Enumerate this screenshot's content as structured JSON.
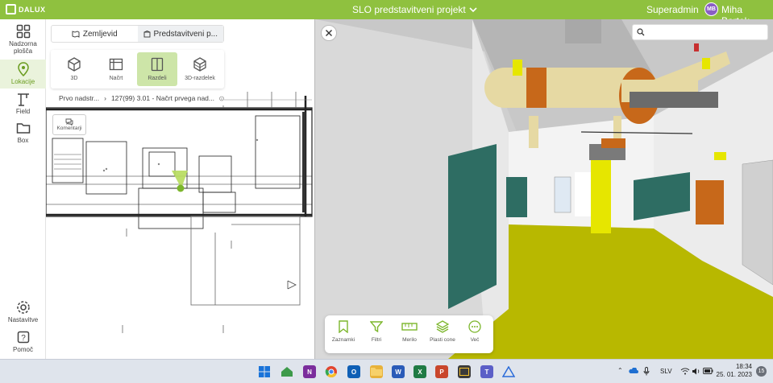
{
  "header": {
    "logo": "DALUX",
    "project_title": "SLO predstavitveni projekt",
    "role": "Superadmin",
    "user_initials": "MB",
    "user_name": "Miha Bartok"
  },
  "sidebar": {
    "items": [
      {
        "label": "Nadzorna plošča",
        "icon": "dashboard-grid-icon"
      },
      {
        "label": "Lokacije",
        "icon": "location-pin-icon",
        "active": true
      },
      {
        "label": "Field",
        "icon": "crane-icon"
      },
      {
        "label": "Box",
        "icon": "folder-icon"
      }
    ],
    "settings_label": "Nastavitve",
    "help_label": "Pomoč",
    "colors": {
      "active": "#6a9c1f",
      "active_bg": "#eaf3dc"
    }
  },
  "plan": {
    "tabs": [
      {
        "label": "Zemljevid",
        "icon": "map-icon"
      },
      {
        "label": "Predstavitveni p...",
        "icon": "building-icon",
        "active": true
      }
    ],
    "views": [
      {
        "label": "3D",
        "icon": "cube-icon"
      },
      {
        "label": "Načrt",
        "icon": "plan-icon"
      },
      {
        "label": "Razdeli",
        "icon": "split-view-icon",
        "active": true
      },
      {
        "label": "3D-razdelek",
        "icon": "section-cube-icon"
      }
    ],
    "breadcrumb": {
      "level": "Prvo nadstr...",
      "drawing": "127(99) 3.01 - Načrt prvega nad..."
    },
    "comments_label": "Komentarji"
  },
  "viewport": {
    "search_placeholder": "",
    "toolbar": [
      {
        "label": "Zaznamki",
        "icon": "bookmark-icon"
      },
      {
        "label": "Filtri",
        "icon": "filter-icon"
      },
      {
        "label": "Merilo",
        "icon": "ruler-icon"
      },
      {
        "label": "Plasti cone",
        "icon": "layers-icon"
      },
      {
        "label": "Več",
        "icon": "more-dots-icon"
      }
    ]
  },
  "taskbar": {
    "language": "SLV",
    "time": "18:34",
    "date": "25. 01. 2023",
    "notifications": "15"
  },
  "colors": {
    "brand": "#8fc13f",
    "floor": "#b8b800",
    "pipe": "#e6d9a3",
    "pipe_band": "#c7681a",
    "panel": "#2e6d63"
  }
}
